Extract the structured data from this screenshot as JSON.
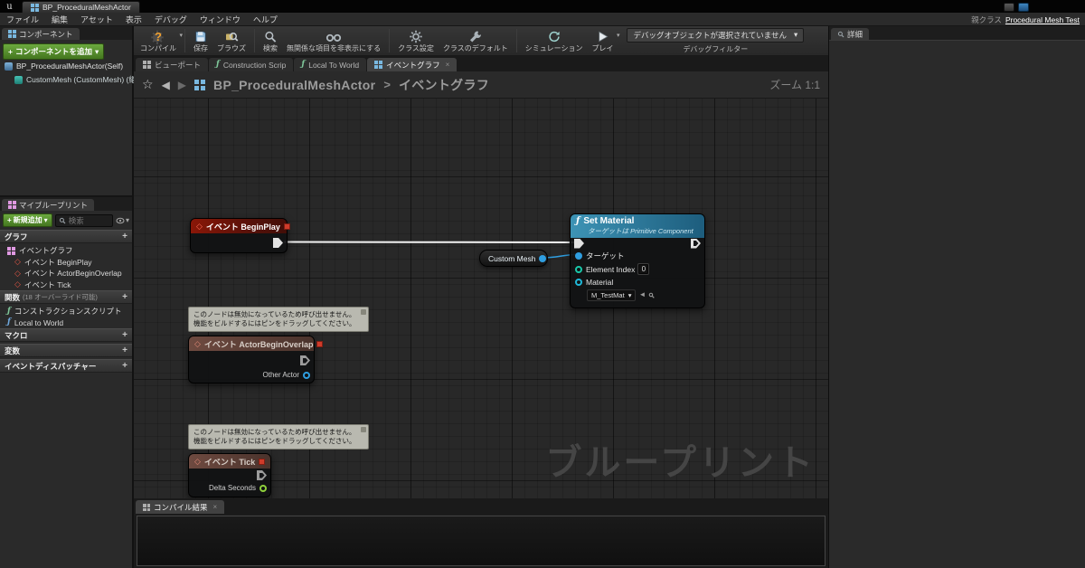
{
  "titlebar": {
    "app_tab": "BP_ProceduralMeshActor"
  },
  "menubar": {
    "items": [
      "ファイル",
      "編集",
      "アセット",
      "表示",
      "デバッグ",
      "ウィンドウ",
      "ヘルプ"
    ],
    "parent_class_label": "親クラス",
    "parent_class_link": "Procedural Mesh Test"
  },
  "toolbar": {
    "buttons": [
      {
        "label": "コンパイル"
      },
      {
        "label": "保存"
      },
      {
        "label": "ブラウズ"
      },
      {
        "label": "検索"
      },
      {
        "label": "無関係な項目を非表示にする"
      },
      {
        "label": "クラス設定"
      },
      {
        "label": "クラスのデフォルト"
      },
      {
        "label": "シミュレーション"
      },
      {
        "label": "プレイ"
      }
    ],
    "debug_dropdown_value": "デバッグオブジェクトが選択されていません",
    "debug_filter_label": "デバッグフィルター"
  },
  "components_panel": {
    "tab_label": "コンポーネント",
    "add_button_label": "コンポーネントを追加",
    "tree": [
      {
        "label": "BP_ProceduralMeshActor(Self)"
      },
      {
        "label": "CustomMesh (CustomMesh) (継承)"
      }
    ]
  },
  "my_blueprint_panel": {
    "tab_label": "マイブループリント",
    "add_new_label": "新規追加",
    "search_placeholder": "検索",
    "sections": {
      "graphs": {
        "label": "グラフ"
      },
      "functions": {
        "label": "関数",
        "hint": "(18 オーバーライド可能)"
      },
      "macros": {
        "label": "マクロ"
      },
      "variables": {
        "label": "変数"
      },
      "dispatchers": {
        "label": "イベントディスパッチャー"
      }
    },
    "graph_group_label": "イベントグラフ",
    "graph_events": [
      {
        "label": "イベント BeginPlay"
      },
      {
        "label": "イベント ActorBeginOverlap"
      },
      {
        "label": "イベント Tick"
      }
    ],
    "functions_items": [
      {
        "label": "コンストラクションスクリプト"
      },
      {
        "label": "Local to World"
      }
    ]
  },
  "doc_tabs": [
    {
      "label": "ビューポート"
    },
    {
      "label": "Construction Scrip"
    },
    {
      "label": "Local To World"
    },
    {
      "label": "イベントグラフ"
    }
  ],
  "breadcrumb": {
    "root": "BP_ProceduralMeshActor",
    "separator": ">",
    "current": "イベントグラフ",
    "zoom_label": "ズーム 1:1"
  },
  "graph": {
    "begin_play": {
      "title": "イベント BeginPlay"
    },
    "set_material": {
      "title": "Set Material",
      "subtitle": "ターゲットは Primitive Component",
      "pins": {
        "target": "ターゲット",
        "element_index": "Element Index",
        "element_index_value": "0",
        "material": "Material",
        "material_value": "M_TestMat"
      }
    },
    "custom_mesh": {
      "label": "Custom Mesh"
    },
    "warning_line1": "このノードは無効になっているため呼び出せません。",
    "warning_line2": "機能をビルドするにはピンをドラッグしてください。",
    "actor_begin_overlap": {
      "title": "イベント ActorBeginOverlap",
      "pin": "Other Actor"
    },
    "tick": {
      "title": "イベント Tick",
      "pin": "Delta Seconds"
    },
    "watermark": "ブループリント"
  },
  "compile_results": {
    "tab_label": "コンパイル結果"
  },
  "details_panel": {
    "tab_label": "詳細"
  },
  "icons": {
    "caret_down": "▾",
    "plus": "+",
    "diamond": "◇",
    "star": "☆",
    "back_arrow": "◀",
    "forward_arrow": "▶",
    "fn": "ƒ",
    "close": "×",
    "left_arrow": "◄",
    "logo": "u"
  },
  "colors": {
    "event_node_red": "#8a1708",
    "function_node_blue": "#3d93b5",
    "exec_wire_white": "#f2f2f2",
    "object_pin_blue": "#2f9ee0",
    "int_pin_teal": "#19c8a9",
    "float_pin_green": "#8fd13c",
    "add_button_green": "#5a9e35",
    "warning_bg": "#b9b9b0",
    "graph_bg": "#282828"
  }
}
